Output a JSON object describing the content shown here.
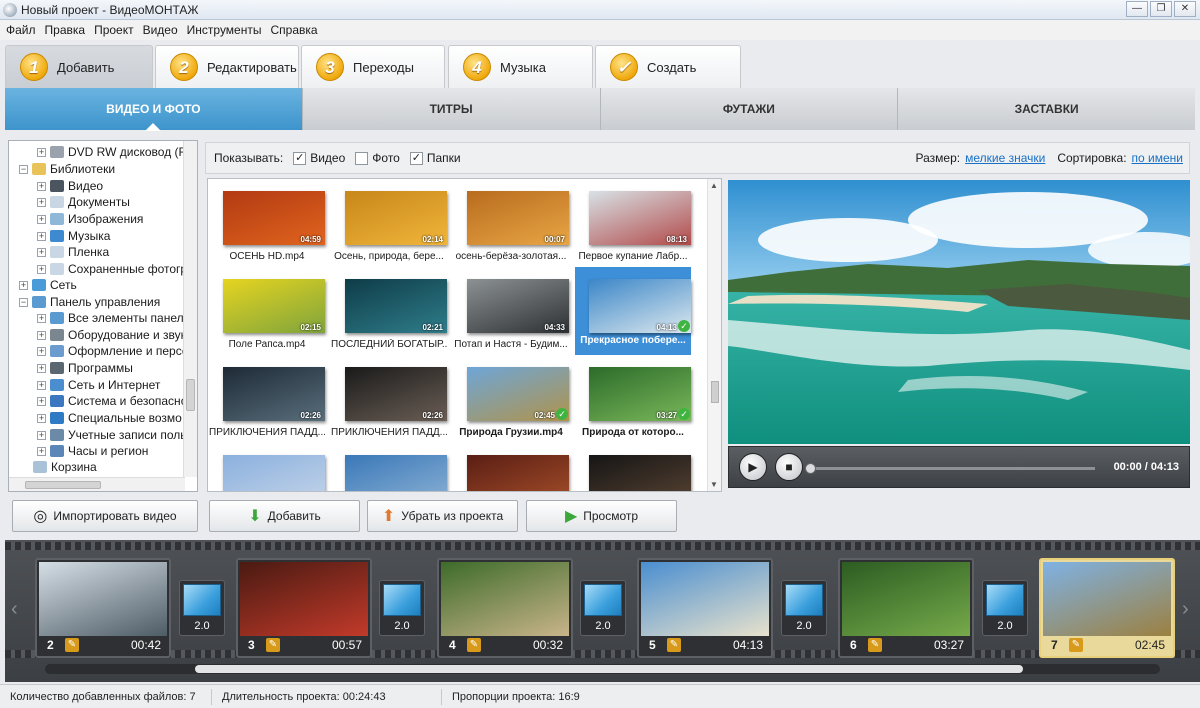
{
  "window": {
    "title": "Новый проект - ВидеоМОНТАЖ",
    "controls": [
      "—",
      "❐",
      "✕"
    ]
  },
  "menu": [
    "Файл",
    "Правка",
    "Проект",
    "Видео",
    "Инструменты",
    "Справка"
  ],
  "steps": [
    {
      "num": "1",
      "label": "Добавить",
      "active": true
    },
    {
      "num": "2",
      "label": "Редактировать"
    },
    {
      "num": "3",
      "label": "Переходы"
    },
    {
      "num": "4",
      "label": "Музыка"
    },
    {
      "num": "✓",
      "label": "Создать"
    }
  ],
  "categories": [
    "ВИДЕО И ФОТО",
    "ТИТРЫ",
    "ФУТАЖИ",
    "ЗАСТАВКИ"
  ],
  "tree": [
    "DVD RW дисковод (F",
    "Библиотеки",
    "Видео",
    "Документы",
    "Изображения",
    "Музыка",
    "Пленка",
    "Сохраненные фотогр",
    "Сеть",
    "Панель управления",
    "Все элементы панелі",
    "Оборудование и звук",
    "Оформление и персо",
    "Программы",
    "Сеть и Интернет",
    "Система и безопасно",
    "Специальные возмо",
    "Учетные записи поль",
    "Часы и регион",
    "Корзина"
  ],
  "filter": {
    "show_label": "Показывать:",
    "video": "Видео",
    "photo": "Фото",
    "folders": "Папки",
    "size_label": "Размер:",
    "size_value": "мелкие значки",
    "sort_label": "Сортировка:",
    "sort_value": "по имени"
  },
  "files": [
    {
      "name": "ОСЕНЬ HD.mp4",
      "dur": "04:59",
      "colors": [
        "#b23a12",
        "#e0641e"
      ]
    },
    {
      "name": "Осень, природа, бере...",
      "dur": "02:14",
      "colors": [
        "#c8871a",
        "#f0b53a"
      ]
    },
    {
      "name": "осень-берёза-золотая...",
      "dur": "00:07",
      "colors": [
        "#b86c1e",
        "#e8a544"
      ]
    },
    {
      "name": "Первое купание Лабр...",
      "dur": "08:13",
      "colors": [
        "#d8e2e6",
        "#b24a4a"
      ]
    },
    {
      "name": "Поле Рапса.mp4",
      "dur": "02:15",
      "colors": [
        "#e6d420",
        "#7fa43c"
      ]
    },
    {
      "name": "ПОСЛЕДНИЙ БОГАТЫР...",
      "dur": "02:21",
      "colors": [
        "#0e3c48",
        "#2f7d8a"
      ]
    },
    {
      "name": "Потап и Настя - Будим...",
      "dur": "04:33",
      "colors": [
        "#8c9194",
        "#2d3134"
      ]
    },
    {
      "name": "Прекрасное побере...",
      "dur": "04:13",
      "colors": [
        "#3b86c8",
        "#dce8ee"
      ],
      "selected": true,
      "added": true
    },
    {
      "name": "ПРИКЛЮЧЕНИЯ ПАДД...",
      "dur": "02:26",
      "colors": [
        "#1d2a36",
        "#5a6e7c"
      ]
    },
    {
      "name": "ПРИКЛЮЧЕНИЯ ПАДД...",
      "dur": "02:26",
      "colors": [
        "#1a1a1a",
        "#6a5e55"
      ]
    },
    {
      "name": "Природа Грузии.mp4",
      "dur": "02:45",
      "colors": [
        "#6ea6d8",
        "#b0934a"
      ],
      "added": true
    },
    {
      "name": "Природа от которо...",
      "dur": "03:27",
      "colors": [
        "#2c6b2a",
        "#7ab85a"
      ],
      "added": true
    },
    {
      "name": "",
      "dur": "",
      "colors": [
        "#8bb0de",
        "#c6d6e9"
      ]
    },
    {
      "name": "",
      "dur": "",
      "colors": [
        "#3a78b8",
        "#8fb4d6"
      ]
    },
    {
      "name": "",
      "dur": "",
      "colors": [
        "#5a1e14",
        "#a8502a"
      ]
    },
    {
      "name": "",
      "dur": "",
      "colors": [
        "#151515",
        "#5b4534"
      ]
    }
  ],
  "player": {
    "time": "00:00 / 04:13",
    "progress": 0
  },
  "buttons": {
    "import": "Импортировать видео",
    "add": "Добавить",
    "remove": "Убрать из проекта",
    "preview": "Просмотр"
  },
  "timeline": {
    "clips": [
      {
        "num": "2",
        "dur": "00:42",
        "colors": [
          "#d6dfe6",
          "#4e5c66"
        ]
      },
      {
        "num": "3",
        "dur": "00:57",
        "colors": [
          "#4a1a12",
          "#c23a2a"
        ]
      },
      {
        "num": "4",
        "dur": "00:32",
        "colors": [
          "#3d6b2a",
          "#c9b48a"
        ]
      },
      {
        "num": "5",
        "dur": "04:13",
        "colors": [
          "#4a8ed0",
          "#e8e2cc"
        ]
      },
      {
        "num": "6",
        "dur": "03:27",
        "colors": [
          "#2c5c22",
          "#76aa4a"
        ]
      },
      {
        "num": "7",
        "dur": "02:45",
        "colors": [
          "#7fb2e4",
          "#9c8040"
        ],
        "active": true
      }
    ],
    "transition_dur": "2.0"
  },
  "status": {
    "files": "Количество добавленных файлов: 7",
    "duration": "Длительность проекта:  00:24:43",
    "ratio": "Пропорции проекта:  16:9"
  }
}
